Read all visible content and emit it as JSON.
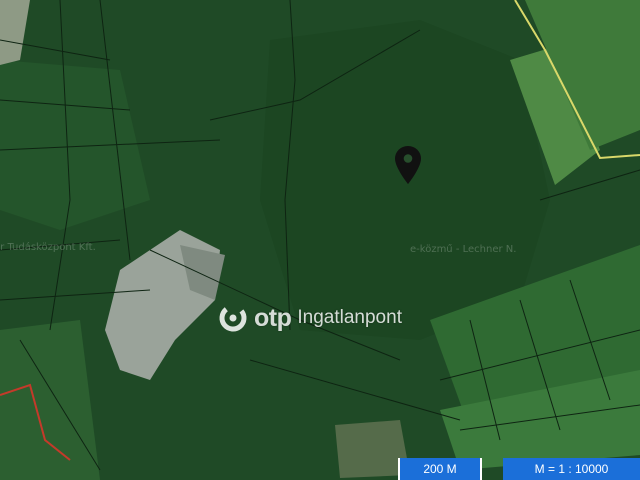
{
  "map": {
    "view": "satellite",
    "palette": {
      "forest_dark": "#1f4a26",
      "forest_mid": "#2a5e30",
      "field_light": "#4f8a45",
      "clearing": "#9aa39a",
      "parcel_line": "#0e2412",
      "road_yellow": "#d9d86a",
      "road_red": "#c43a2a"
    }
  },
  "marker": {
    "icon": "map-pin-icon",
    "color": "#111111"
  },
  "watermark": {
    "brand": "otp",
    "product": "Ingatlanpont"
  },
  "credits": {
    "right": "e-közmű - Lechner N.",
    "left": "er Tudásközpont Kft."
  },
  "scale": {
    "distance": "200 M",
    "ratio": "M = 1 : 10000"
  }
}
